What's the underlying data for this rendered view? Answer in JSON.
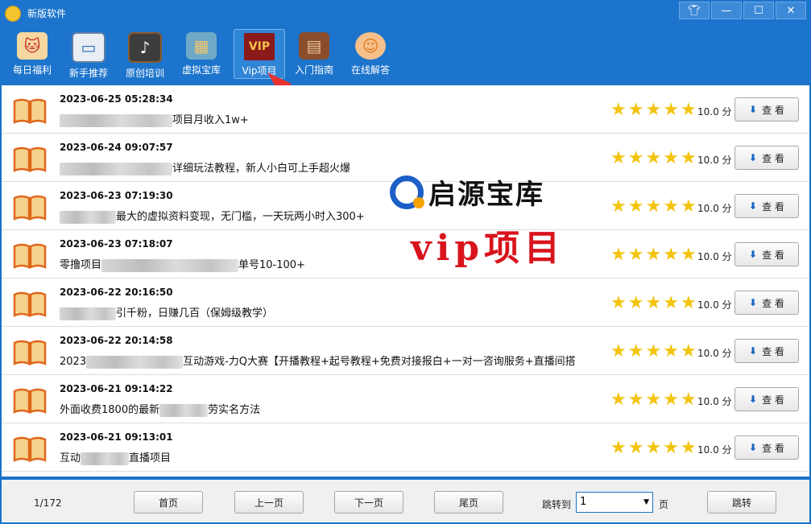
{
  "window": {
    "title": "新版软件",
    "controls": [
      "shirt-icon",
      "minimize-icon",
      "maximize-icon",
      "close-icon"
    ]
  },
  "toolbar": {
    "items": [
      {
        "label": "每日福利",
        "icon": "lucky-cat-icon"
      },
      {
        "label": "新手推荐",
        "icon": "monitor-icon"
      },
      {
        "label": "原创培训",
        "icon": "chalkboard-icon"
      },
      {
        "label": "虚拟宝库",
        "icon": "warehouse-icon"
      },
      {
        "label": "Vip项目",
        "icon": "vip-icon",
        "active": true
      },
      {
        "label": "入门指南",
        "icon": "book-guide-icon"
      },
      {
        "label": "在线解答",
        "icon": "support-agent-icon"
      }
    ]
  },
  "vip_badge": "VIP",
  "list": {
    "rows": [
      {
        "date": "2023-06-25 05:28:34",
        "title_suffix": "项目月收入1w+",
        "score": "10.0 分",
        "view": "查 看",
        "rating": 5
      },
      {
        "date": "2023-06-24 09:07:57",
        "title_suffix": "详细玩法教程，新人小白可上手超火爆",
        "score": "10.0 分",
        "view": "查 看",
        "rating": 5
      },
      {
        "date": "2023-06-23 07:19:30",
        "title_suffix": "最大的虚拟资料变现，无门槛，一天玩两小时入300+",
        "score": "10.0 分",
        "view": "查 看",
        "rating": 5
      },
      {
        "date": "2023-06-23 07:18:07",
        "title_prefix": "零撸项目",
        "title_suffix": "单号10-100+",
        "score": "10.0 分",
        "view": "查 看",
        "rating": 5
      },
      {
        "date": "2023-06-22 20:16:50",
        "title_suffix": "引千粉，日赚几百（保姆级教学）",
        "score": "10.0 分",
        "view": "查 看",
        "rating": 5
      },
      {
        "date": "2023-06-22 20:14:58",
        "title_prefix": "2023",
        "title_suffix": "互动游戏-力Q大赛【开播教程+起号教程+免费对接报白+一对一咨询服务+直播间搭",
        "score": "10.0 分",
        "view": "查 看",
        "rating": 5
      },
      {
        "date": "2023-06-21 09:14:22",
        "title_prefix": "外面收费1800的最新",
        "title_suffix": "劳实名方法",
        "score": "10.0 分",
        "view": "查 看",
        "rating": 5
      },
      {
        "date": "2023-06-21 09:13:01",
        "title_prefix": "互动",
        "title_suffix": "直播项目",
        "score": "10.0 分",
        "view": "查 看",
        "rating": 5
      }
    ]
  },
  "footer": {
    "page_info": "1/172",
    "first": "首页",
    "prev": "上一页",
    "next": "下一页",
    "last": "尾页",
    "jump_label": "跳转到",
    "jump_value": "1",
    "page_unit": "页",
    "jump_button": "跳转"
  },
  "overlay": {
    "brand": "启源宝库",
    "vip": "vip项目"
  },
  "colors": {
    "titlebar": "#1c74cc",
    "star": "#f3c40e",
    "accent_red": "#d8141c"
  }
}
